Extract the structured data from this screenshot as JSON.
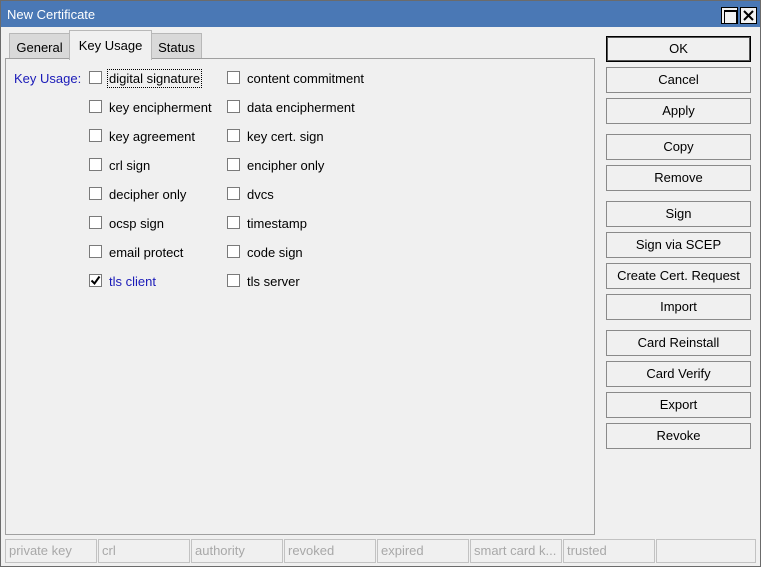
{
  "window": {
    "title": "New Certificate"
  },
  "tabs": [
    {
      "label": "General"
    },
    {
      "label": "Key Usage"
    },
    {
      "label": "Status"
    }
  ],
  "key_usage": {
    "label": "Key Usage:",
    "left_column": [
      {
        "label": "digital signature",
        "checked": false
      },
      {
        "label": "key encipherment",
        "checked": false
      },
      {
        "label": "key agreement",
        "checked": false
      },
      {
        "label": "crl sign",
        "checked": false
      },
      {
        "label": "decipher only",
        "checked": false
      },
      {
        "label": "ocsp sign",
        "checked": false
      },
      {
        "label": "email protect",
        "checked": false
      },
      {
        "label": "tls client",
        "checked": true
      }
    ],
    "right_column": [
      {
        "label": "content commitment",
        "checked": false
      },
      {
        "label": "data encipherment",
        "checked": false
      },
      {
        "label": "key cert. sign",
        "checked": false
      },
      {
        "label": "encipher only",
        "checked": false
      },
      {
        "label": "dvcs",
        "checked": false
      },
      {
        "label": "timestamp",
        "checked": false
      },
      {
        "label": "code sign",
        "checked": false
      },
      {
        "label": "tls server",
        "checked": false
      }
    ]
  },
  "buttons": {
    "ok": "OK",
    "cancel": "Cancel",
    "apply": "Apply",
    "copy": "Copy",
    "remove": "Remove",
    "sign": "Sign",
    "sign_scep": "Sign via SCEP",
    "create_request": "Create Cert. Request",
    "import": "Import",
    "card_reinstall": "Card Reinstall",
    "card_verify": "Card Verify",
    "export": "Export",
    "revoke": "Revoke"
  },
  "status_bar": [
    "private key",
    "crl",
    "authority",
    "revoked",
    "expired",
    "smart card k...",
    "trusted",
    ""
  ],
  "colors": {
    "titlebar": "#4a78b5",
    "label_blue": "#1a1ab8",
    "window_bg": "#f0f0f0"
  }
}
